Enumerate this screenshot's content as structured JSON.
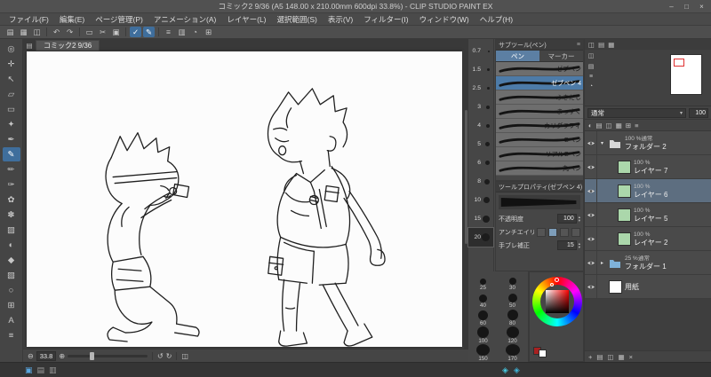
{
  "titlebar": {
    "title": "コミック2 9/36 (A5 148.00 x 210.00mm 600dpi 33.8%) - CLIP STUDIO PAINT EX",
    "minimize": "–",
    "maximize": "□",
    "close": "×"
  },
  "menubar": {
    "items": [
      "ファイル(F)",
      "編集(E)",
      "ページ管理(P)",
      "アニメーション(A)",
      "レイヤー(L)",
      "選択範囲(S)",
      "表示(V)",
      "フィルター(I)",
      "ウィンドウ(W)",
      "ヘルプ(H)"
    ]
  },
  "command_bar": {
    "icons": [
      {
        "g": "▤",
        "name": "new-page-icon"
      },
      {
        "g": "▦",
        "name": "open-icon"
      },
      {
        "g": "◫",
        "name": "save-icon"
      },
      {
        "sep": true
      },
      {
        "g": "↶",
        "name": "undo-icon"
      },
      {
        "g": "↷",
        "name": "redo-icon"
      },
      {
        "sep": true
      },
      {
        "g": "▭",
        "name": "selection-icon"
      },
      {
        "g": "✂",
        "name": "cut-icon"
      },
      {
        "g": "▣",
        "name": "paste-icon"
      },
      {
        "sep": true
      },
      {
        "g": "✓",
        "name": "snap-toggle-icon",
        "active": true
      },
      {
        "g": "✎",
        "name": "pen-input-icon",
        "active": true
      },
      {
        "sep": true
      },
      {
        "g": "≡",
        "name": "grid-icon"
      },
      {
        "g": "▥",
        "name": "material-icon"
      },
      {
        "g": "◔",
        "name": "rotate-view-icon"
      },
      {
        "g": "⊞",
        "name": "workspace-icon"
      }
    ]
  },
  "toolbox": {
    "tools": [
      {
        "g": "◎",
        "name": "tool-zoom"
      },
      {
        "g": "✛",
        "name": "tool-move"
      },
      {
        "g": "↖",
        "name": "tool-operate"
      },
      {
        "g": "▱",
        "name": "tool-layer-move"
      },
      {
        "g": "▭",
        "name": "tool-selection"
      },
      {
        "g": "✦",
        "name": "tool-auto-select"
      },
      {
        "g": "✒",
        "name": "tool-eyedropper"
      },
      {
        "g": "✎",
        "name": "tool-pen",
        "active": true
      },
      {
        "g": "✏",
        "name": "tool-pencil"
      },
      {
        "g": "✑",
        "name": "tool-brush"
      },
      {
        "g": "✿",
        "name": "tool-airbrush"
      },
      {
        "g": "✽",
        "name": "tool-decoration"
      },
      {
        "g": "▨",
        "name": "tool-eraser"
      },
      {
        "g": "◐",
        "name": "tool-blend"
      },
      {
        "g": "◆",
        "name": "tool-fill"
      },
      {
        "g": "▧",
        "name": "tool-gradient"
      },
      {
        "g": "○",
        "name": "tool-figure"
      },
      {
        "g": "⊞",
        "name": "tool-frame"
      },
      {
        "g": "A",
        "name": "tool-text"
      },
      {
        "g": "≡",
        "name": "tool-ruler"
      }
    ]
  },
  "document_area": {
    "tab_label": "コミック2 9/36",
    "zoom": "33.8"
  },
  "subtool": {
    "title": "サブツール(ペン)",
    "tabs": [
      {
        "label": "ペン",
        "active": true
      },
      {
        "label": "マーカー"
      }
    ],
    "pens": [
      {
        "label": "ゼブペン"
      },
      {
        "label": "ゼブペン 4",
        "selected": true
      },
      {
        "label": "ふきだし"
      },
      {
        "label": "まっすぐ"
      },
      {
        "label": "カリグラフィ"
      },
      {
        "label": "Gペン"
      },
      {
        "label": "リアルGペン"
      },
      {
        "label": "丸ペン"
      }
    ]
  },
  "tool_property": {
    "title": "ツールプロパティ(ゼブペン 4)",
    "opacity_label": "不透明度",
    "opacity_value": "100",
    "aa_label": "アンチエイリアス",
    "stabilize_label": "手ブレ補正",
    "stabilize_value": "15"
  },
  "brush_sizes": {
    "list": [
      {
        "v": "0.7",
        "d": 2
      },
      {
        "v": "1.5",
        "d": 3
      },
      {
        "v": "2.5",
        "d": 3
      },
      {
        "v": "3",
        "d": 4
      },
      {
        "v": "4",
        "d": 4
      },
      {
        "v": "5",
        "d": 5
      },
      {
        "v": "6",
        "d": 5
      },
      {
        "v": "8",
        "d": 6
      },
      {
        "v": "10",
        "d": 7
      },
      {
        "v": "15",
        "d": 8
      },
      {
        "v": "20",
        "d": 9,
        "selected": true
      }
    ],
    "grid": [
      {
        "v": "25",
        "d": 7
      },
      {
        "v": "30",
        "d": 8
      },
      {
        "v": "40",
        "d": 9
      },
      {
        "v": "50",
        "d": 10
      },
      {
        "v": "60",
        "d": 11
      },
      {
        "v": "80",
        "d": 12
      },
      {
        "v": "100",
        "d": 13
      },
      {
        "v": "120",
        "d": 14
      },
      {
        "v": "150",
        "d": 15
      },
      {
        "v": "170",
        "d": 16
      }
    ]
  },
  "color_wheel": {
    "current": "#a82020"
  },
  "navigator": {
    "icons": [
      {
        "g": "◫"
      },
      {
        "g": "▤"
      },
      {
        "g": "≡"
      },
      {
        "g": "◔"
      }
    ]
  },
  "layers": {
    "tab_icons": [
      {
        "g": "◫"
      },
      {
        "g": "▤"
      },
      {
        "g": "▦"
      }
    ],
    "blend": "通常",
    "opacity": "100",
    "toolbar_icons": [
      {
        "g": "◐"
      },
      {
        "g": "▤"
      },
      {
        "g": "◫"
      },
      {
        "g": "▦"
      },
      {
        "g": "⊞"
      },
      {
        "g": "≡"
      }
    ],
    "bottom_icons": [
      {
        "g": "+"
      },
      {
        "g": "▤"
      },
      {
        "g": "◫"
      },
      {
        "g": "▦"
      },
      {
        "g": "×"
      }
    ],
    "items": [
      {
        "type": "folder",
        "opacity": "100 %通常",
        "name": "フォルダー 2",
        "chip": "#d8d8d8"
      },
      {
        "type": "layer",
        "opacity": "100 %",
        "name": "レイヤー 7",
        "chip": "#abd7ab",
        "indent": true
      },
      {
        "type": "layer",
        "opacity": "100 %",
        "name": "レイヤー 6",
        "chip": "#abd7ab",
        "indent": true,
        "selected": true
      },
      {
        "type": "layer",
        "opacity": "100 %",
        "name": "レイヤー 5",
        "chip": "#abd7ab",
        "indent": true
      },
      {
        "type": "layer",
        "opacity": "100 %",
        "name": "レイヤー 2",
        "chip": "#abd7ab",
        "indent": true
      },
      {
        "type": "folder",
        "opacity": "25 %通常",
        "name": "フォルダー 1",
        "chip": "#7fb2d9",
        "expanded": false
      },
      {
        "type": "paper",
        "opacity": "",
        "name": "用紙",
        "chip": "#ffffff"
      }
    ]
  },
  "status_strip": {
    "left_icons": [
      {
        "g": "▣",
        "color": "#5aa7e0"
      },
      {
        "g": "▤"
      },
      {
        "g": "▥"
      }
    ],
    "mid_icons": [
      {
        "g": "◈",
        "color": "#46c8e0"
      },
      {
        "g": "◈",
        "color": "#3fb4d8"
      }
    ]
  },
  "glyphs": {
    "caret": "▾",
    "minus": "⊖",
    "plus": "⊕",
    "rotate_left": "↺",
    "rotate_right": "↻",
    "fit": "◫",
    "panel_menu": "≡",
    "spin_up": "▴",
    "spin_down": "▾",
    "tab_page": "▤"
  },
  "accent": {
    "selection_blue": "#4d7ba8"
  }
}
